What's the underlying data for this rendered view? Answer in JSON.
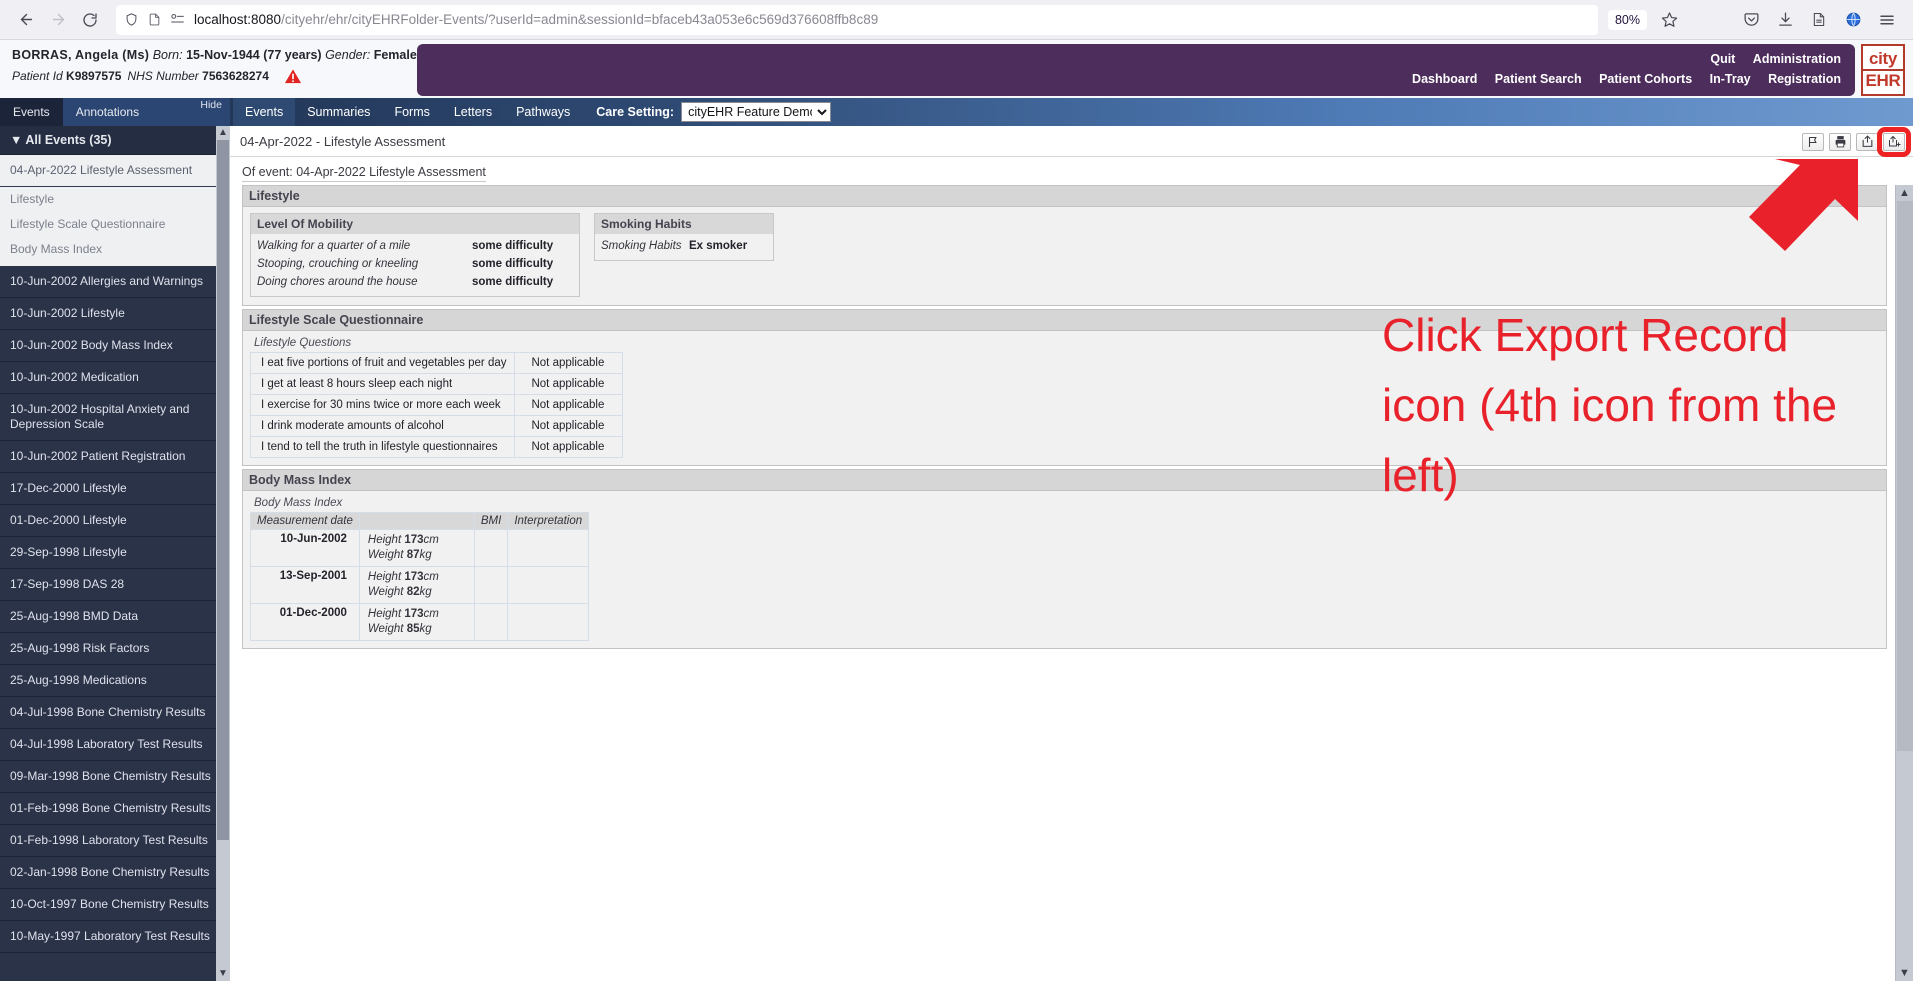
{
  "browser": {
    "back_icon": "back-arrow",
    "forward_icon": "forward-arrow",
    "reload_icon": "reload",
    "url_prefix": "localhost:8080",
    "url_rest": "/cityehr/ehr/cityEHRFolder-Events/?userId=admin&sessionId=bfaceb43a053e6c569d376608ffb8c89",
    "zoom_level": "80%",
    "shield_icon": "shield-icon",
    "page_icon": "page-icon",
    "permissions_icon": "permissions-icon",
    "bookmark_icon": "star-icon",
    "pocket_icon": "pocket-icon",
    "downloads_icon": "download-icon",
    "reader_icon": "reader-icon",
    "account_icon": "account-globe-icon",
    "menu_icon": "hamburger-menu-icon"
  },
  "patient": {
    "name": "BORRAS,  Angela  (Ms)",
    "born_label": "Born:",
    "born_value": "15-Nov-1944",
    "age": "(77 years)",
    "gender_label": "Gender:",
    "gender_value": "Female",
    "patient_id_label": "Patient Id",
    "patient_id_value": "K9897575",
    "nhs_label": "NHS Number",
    "nhs_value": "7563628274",
    "alert_icon": "warning-triangle-icon"
  },
  "top_nav": {
    "row1": [
      "Quit",
      "Administration"
    ],
    "row2": [
      "Dashboard",
      "Patient Search",
      "Patient Cohorts",
      "In-Tray",
      "Registration"
    ],
    "logo_top": "city",
    "logo_bottom": "EHR"
  },
  "left_tabs": {
    "items": [
      "Events",
      "Annotations"
    ],
    "active": "Events",
    "hide_label": "Hide"
  },
  "main_tabs": {
    "items": [
      "Events",
      "Summaries",
      "Forms",
      "Letters",
      "Pathways"
    ],
    "active": "Events",
    "care_setting_label": "Care Setting:",
    "care_setting_value": "cityEHR Feature Demo",
    "care_setting_options": [
      "cityEHR Feature Demo"
    ]
  },
  "sidebar": {
    "header": "All Events (35)",
    "collapse_icon": "triangle-down-icon",
    "selected": "04-Apr-2022 Lifestyle Assessment",
    "selected_children": [
      "Lifestyle",
      "Lifestyle Scale Questionnaire",
      "Body Mass Index"
    ],
    "items": [
      "10-Jun-2002 Allergies and Warnings",
      "10-Jun-2002 Lifestyle",
      "10-Jun-2002 Body Mass Index",
      "10-Jun-2002 Medication",
      "10-Jun-2002 Hospital Anxiety and Depression Scale",
      "10-Jun-2002 Patient Registration",
      "17-Dec-2000 Lifestyle",
      "01-Dec-2000 Lifestyle",
      "29-Sep-1998 Lifestyle",
      "17-Sep-1998 DAS 28",
      "25-Aug-1998 BMD Data",
      "25-Aug-1998 Risk Factors",
      "25-Aug-1998 Medications",
      "04-Jul-1998 Bone Chemistry Results",
      "04-Jul-1998 Laboratory Test Results",
      "09-Mar-1998 Bone Chemistry Results",
      "01-Feb-1998 Bone Chemistry Results",
      "01-Feb-1998 Laboratory Test Results",
      "02-Jan-1998 Bone Chemistry Results",
      "10-Oct-1997 Bone Chemistry Results",
      "10-May-1997 Laboratory Test Results"
    ]
  },
  "main": {
    "title": "04-Apr-2022 - Lifestyle Assessment",
    "of_event": "Of event: 04-Apr-2022 Lifestyle Assessment",
    "toolbar": [
      {
        "name": "flag-icon",
        "label": "Flag"
      },
      {
        "name": "printer-icon",
        "label": "Print"
      },
      {
        "name": "share-icon",
        "label": "Share"
      },
      {
        "name": "export-record-icon",
        "label": "Export Record"
      }
    ],
    "lifestyle": {
      "title": "Lifestyle",
      "mobility": {
        "title": "Level Of Mobility",
        "rows": [
          {
            "question": "Walking for a quarter of a mile",
            "answer": "some difficulty"
          },
          {
            "question": "Stooping, crouching or kneeling",
            "answer": "some difficulty"
          },
          {
            "question": "Doing chores around the house",
            "answer": "some difficulty"
          }
        ]
      },
      "smoking": {
        "title": "Smoking Habits",
        "rows": [
          {
            "question": "Smoking Habits",
            "answer": "Ex smoker"
          }
        ]
      }
    },
    "questionnaire": {
      "title": "Lifestyle Scale Questionnaire",
      "sub_label": "Lifestyle Questions",
      "rows": [
        {
          "question": "I eat five portions of fruit and vegetables per day",
          "answer": "Not applicable"
        },
        {
          "question": "I get at least 8 hours sleep each night",
          "answer": "Not applicable"
        },
        {
          "question": "I exercise for 30 mins twice or more each week",
          "answer": "Not applicable"
        },
        {
          "question": "I drink moderate amounts of alcohol",
          "answer": "Not applicable"
        },
        {
          "question": "I tend to tell the truth in lifestyle questionnaires",
          "answer": "Not applicable"
        }
      ]
    },
    "bmi": {
      "title": "Body Mass Index",
      "sub_label": "Body Mass Index",
      "columns": [
        "Measurement date",
        "",
        "BMI",
        "Interpretation"
      ],
      "rows": [
        {
          "date": "10-Jun-2002",
          "height_label": "Height",
          "height": "173",
          "height_unit": "cm",
          "weight_label": "Weight",
          "weight": "87",
          "weight_unit": "kg",
          "bmi": "",
          "interpretation": ""
        },
        {
          "date": "13-Sep-2001",
          "height_label": "Height",
          "height": "173",
          "height_unit": "cm",
          "weight_label": "Weight",
          "weight": "82",
          "weight_unit": "kg",
          "bmi": "",
          "interpretation": ""
        },
        {
          "date": "01-Dec-2000",
          "height_label": "Height",
          "height": "173",
          "height_unit": "cm",
          "weight_label": "Weight",
          "weight": "85",
          "weight_unit": "kg",
          "bmi": "",
          "interpretation": ""
        }
      ]
    }
  },
  "annotation": {
    "text": "Click Export Record icon (4th icon from the left)",
    "color": "#e8212b",
    "arrow_icon": "up-right-arrow-icon"
  }
}
